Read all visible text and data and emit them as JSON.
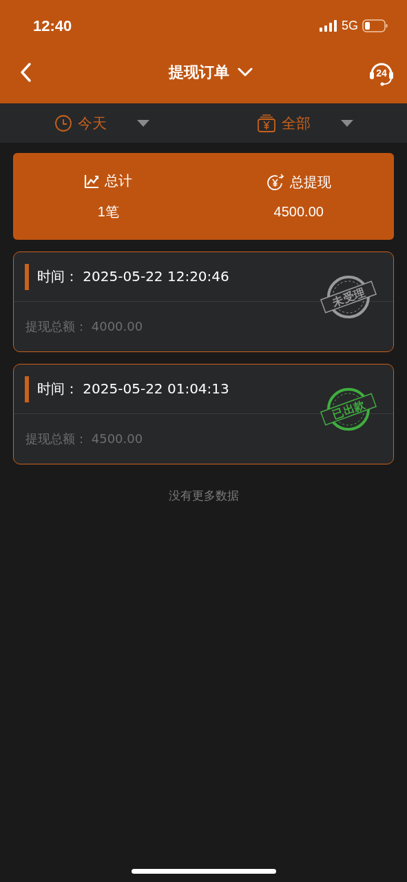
{
  "status_bar": {
    "time": "12:40",
    "network": "5G"
  },
  "header": {
    "title": "提现订单",
    "support_badge": "24"
  },
  "filters": [
    {
      "kind": "date",
      "label": "今天"
    },
    {
      "kind": "type",
      "label": "全部"
    }
  ],
  "summary": [
    {
      "kind": "count",
      "label": "总计",
      "value": "1笔"
    },
    {
      "kind": "amount",
      "label": "总提现",
      "value": "4500.00"
    }
  ],
  "orders": [
    {
      "time_label": "时间：",
      "time": "2025-05-22 12:20:46",
      "amount_label": "提现总额：",
      "amount": "4000.00",
      "stamp": "未受理",
      "color": "#9a9a9a"
    },
    {
      "time_label": "时间：",
      "time": "2025-05-22 01:04:13",
      "amount_label": "提现总额：",
      "amount": "4500.00",
      "stamp": "已出款",
      "color": "#3fae3f"
    }
  ],
  "footer": "没有更多数据"
}
